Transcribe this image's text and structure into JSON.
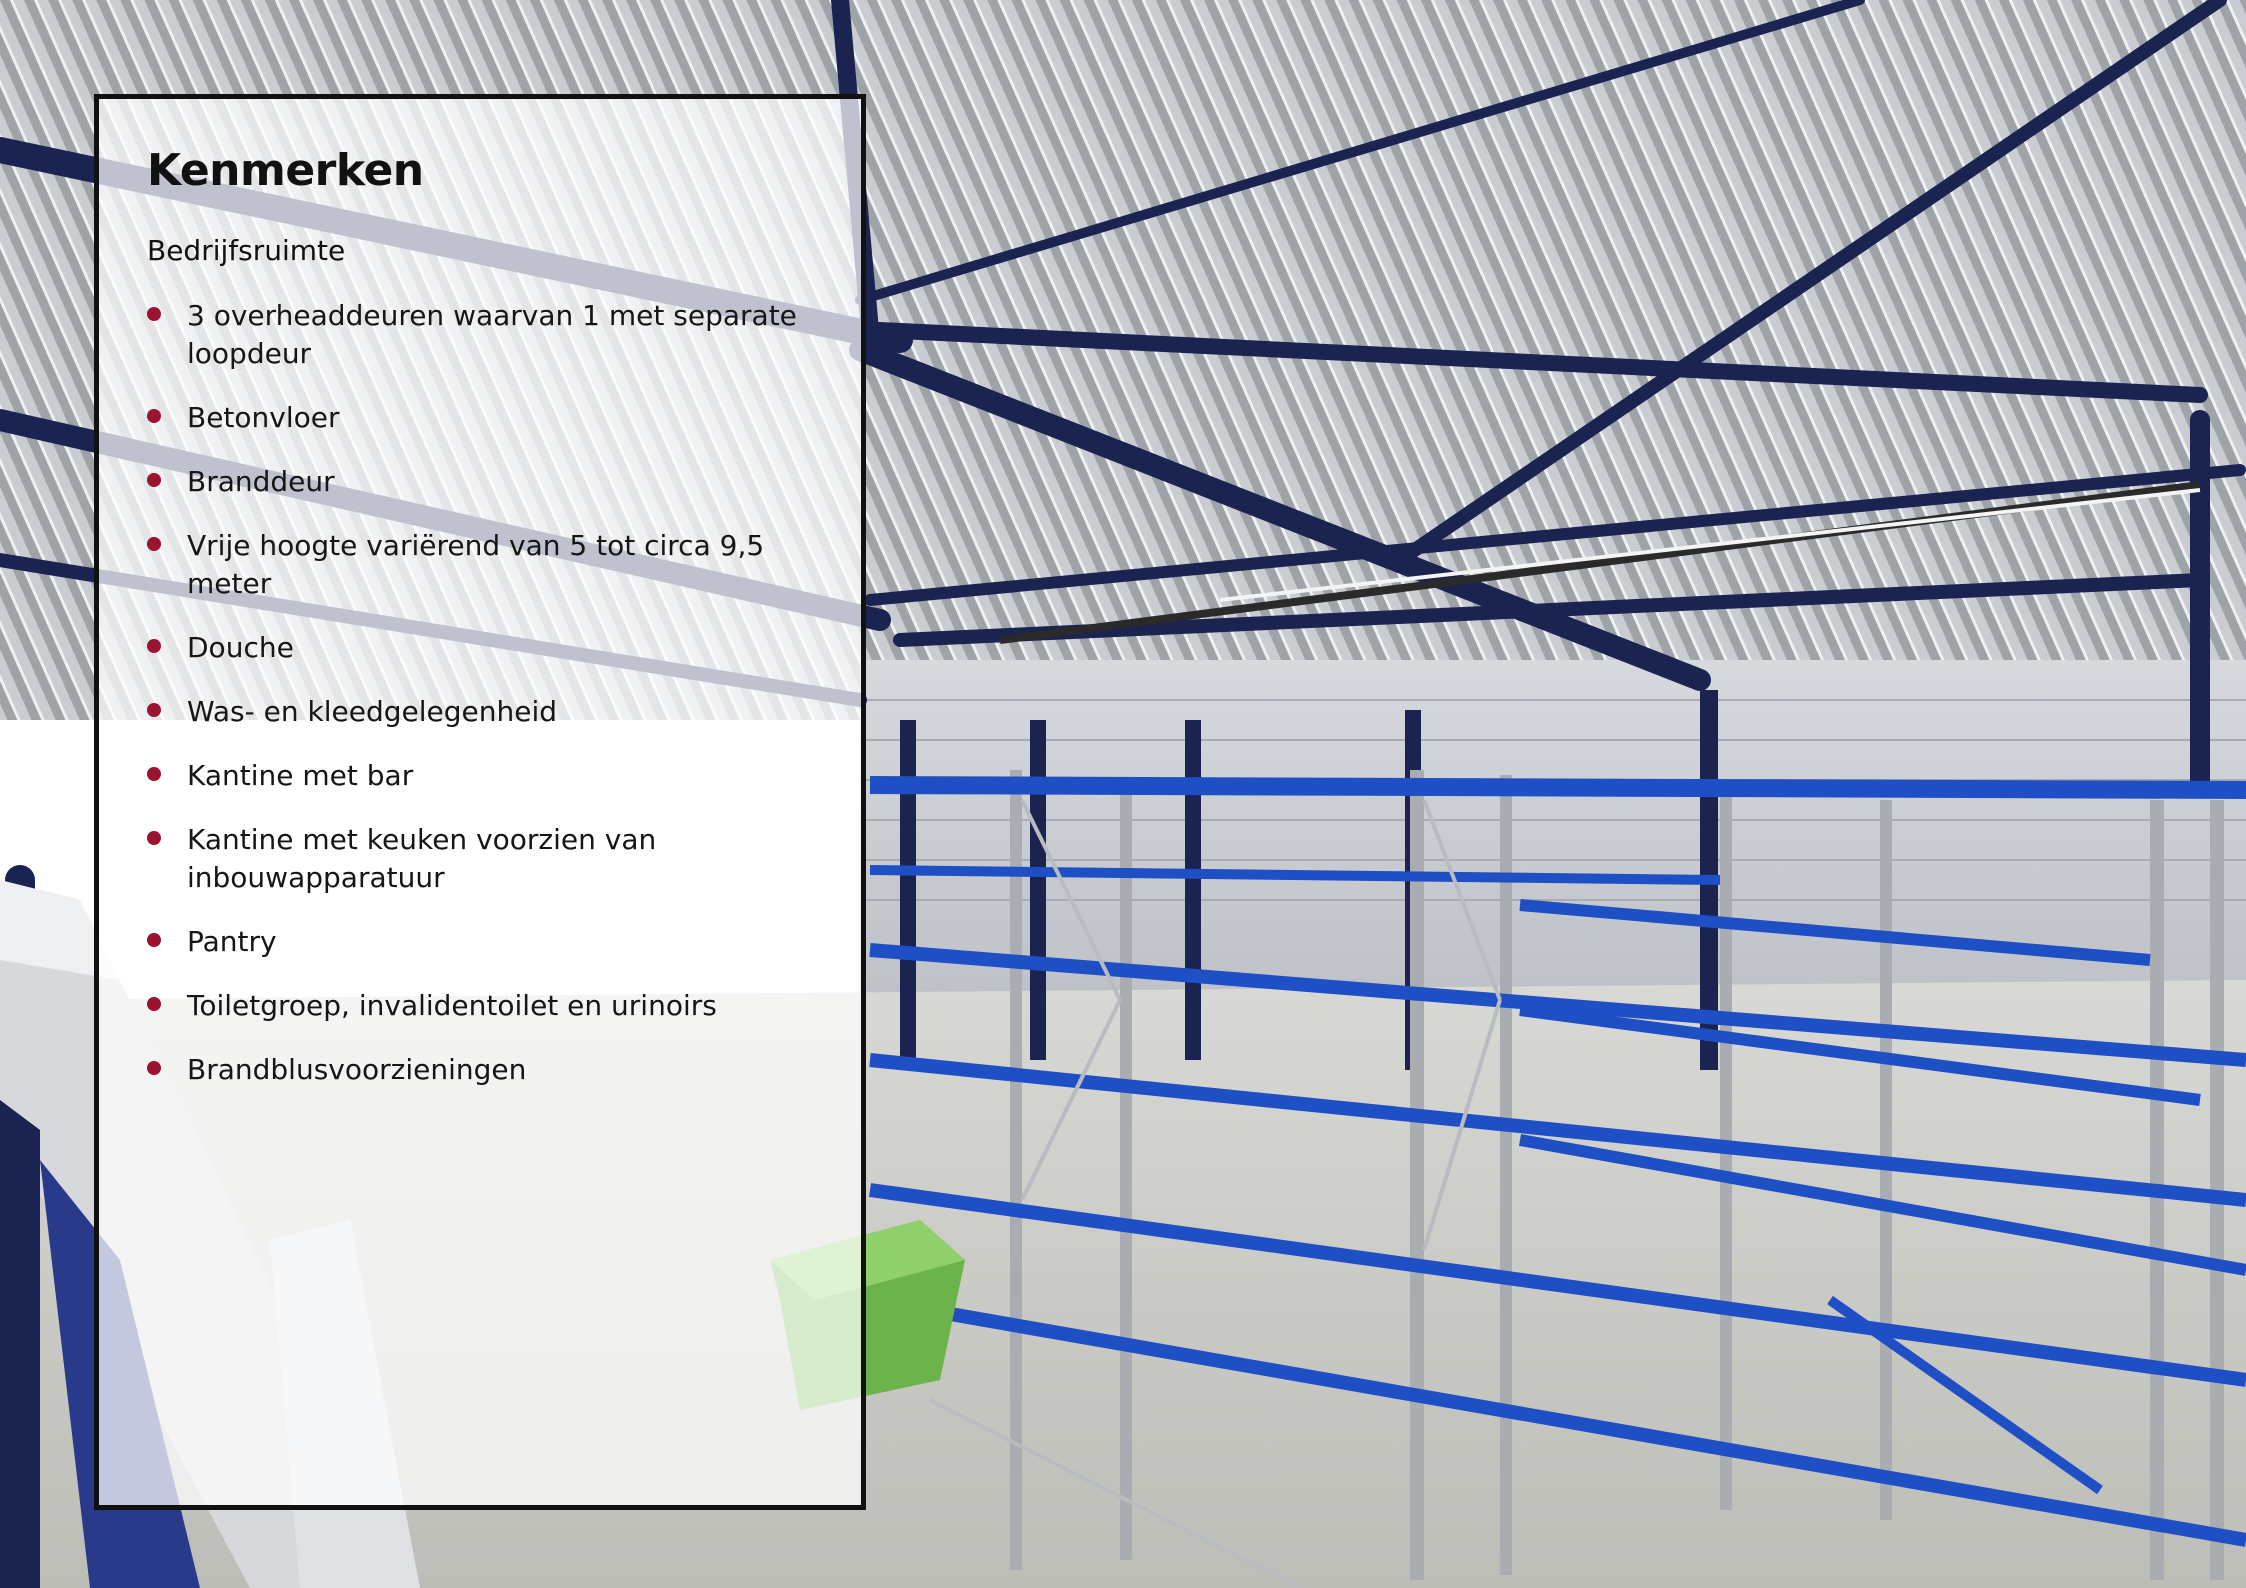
{
  "panel": {
    "title": "Kenmerken",
    "subtitle": "Bedrijfsruimte",
    "bullet_color": "#9b1330",
    "items": [
      "3 overheaddeuren waarvan 1 met separate loopdeur",
      "Betonvloer",
      "Branddeur",
      "Vrije hoogte variërend van 5 tot circa 9,5 meter",
      "Douche",
      "Was- en kleedgelegenheid",
      "Kantine met bar",
      "Kantine met keuken voorzien van inbouwapparatuur",
      "Pantry",
      "Toiletgroep, invalidentoilet en urinoirs",
      "Brandblusvoorzieningen"
    ]
  },
  "colors": {
    "rack_blue": "#1f4fc4",
    "steel_navy": "#1b2350",
    "floor": "#cfcfcb"
  }
}
